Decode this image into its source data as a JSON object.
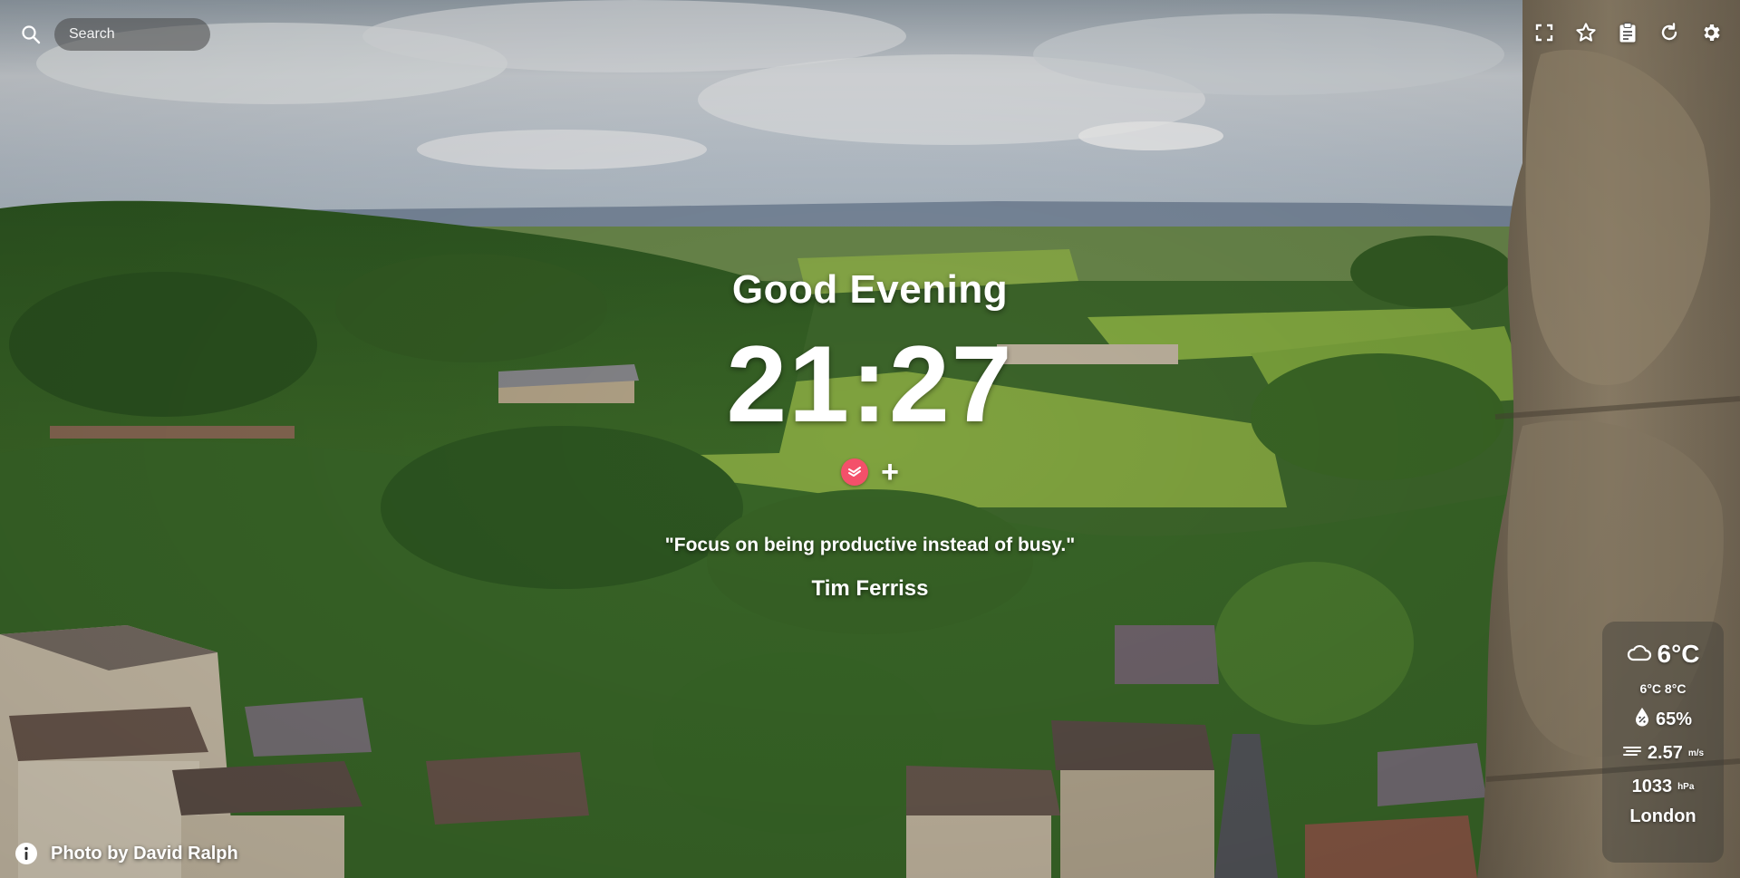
{
  "search": {
    "placeholder": "Search"
  },
  "toolbar": {
    "icons": [
      "fullscreen-icon",
      "star-icon",
      "clipboard-icon",
      "refresh-icon",
      "gear-icon"
    ]
  },
  "main": {
    "greeting": "Good Evening",
    "time": "21:27",
    "quick_links": {
      "app_icon": "todoist-icon",
      "add_label": "+"
    }
  },
  "quote": {
    "text": "\"Focus on being productive instead of busy.\"",
    "author": "Tim Ferriss"
  },
  "weather": {
    "condition_icon": "cloud-icon",
    "temperature": "6°C",
    "min_max": "6°C 8°C",
    "humidity": "65%",
    "wind_speed": "2.57",
    "wind_unit": "m/s",
    "pressure": "1033",
    "pressure_unit": "hPa",
    "city": "London"
  },
  "photo_credit": {
    "text": "Photo by David Ralph"
  },
  "colors": {
    "sky": "#c9d0d6",
    "foliage": "#3d6a2a",
    "field": "#7fa63b",
    "stone_wall": "#8a7b63",
    "accent_app": "#f4506a"
  }
}
